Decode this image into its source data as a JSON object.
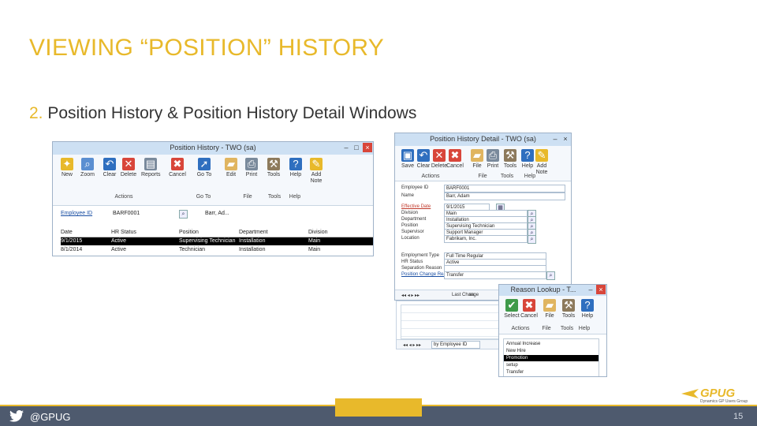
{
  "slide": {
    "title": "VIEWING “POSITION” HISTORY",
    "subtitle_number": "2.",
    "subtitle_text": "Position History & Position History Detail Windows"
  },
  "position_history": {
    "title": "Position History  -  TWO (sa)",
    "ribbon": [
      {
        "label": "New",
        "icon": "new-icon",
        "color": "#e8b92b"
      },
      {
        "label": "Zoom",
        "icon": "zoom-icon",
        "color": "#5b8fd1"
      },
      {
        "label": "Clear",
        "icon": "clear-icon",
        "color": "#2f6fbf"
      },
      {
        "label": "Delete",
        "icon": "delete-icon",
        "color": "#d8463a"
      },
      {
        "label": "Reports",
        "icon": "reports-icon",
        "color": "#7a8a9c"
      },
      {
        "label": "Cancel",
        "icon": "cancel-icon",
        "color": "#d8463a"
      },
      {
        "label": "Go To",
        "icon": "goto-icon",
        "color": "#2f6fbf"
      },
      {
        "label": "Edit",
        "icon": "folder-icon",
        "color": "#e0b560"
      },
      {
        "label": "Print",
        "icon": "print-icon",
        "color": "#7a8a9c"
      },
      {
        "label": "Tools",
        "icon": "tools-icon",
        "color": "#8d7a5c"
      },
      {
        "label": "Help",
        "icon": "help-icon",
        "color": "#2f6fbf"
      },
      {
        "label": "Add Note",
        "icon": "note-icon",
        "color": "#e8b92b"
      }
    ],
    "groups": {
      "actions": "Actions",
      "goto": "Go To",
      "file": "File",
      "tools": "Tools",
      "help": "Help"
    },
    "employee_id_label": "Employee ID",
    "employee_id": "BARF0001",
    "employee_name": "Barr, Ad...",
    "columns": [
      "Date",
      "HR Status",
      "Position",
      "Department",
      "Division"
    ],
    "rows": [
      {
        "date": "9/1/2015",
        "status": "Active",
        "position": "Supervising Technician",
        "department": "Installation",
        "division": "Main",
        "selected": true
      },
      {
        "date": "8/1/2014",
        "status": "Active",
        "position": "Technician",
        "department": "Installation",
        "division": "Main",
        "selected": false
      }
    ]
  },
  "position_detail": {
    "title": "Position History Detail  -  TWO (sa)",
    "ribbon": [
      {
        "label": "Save",
        "icon": "save-icon",
        "color": "#2f6fbf"
      },
      {
        "label": "Clear",
        "icon": "clear-icon",
        "color": "#2f6fbf"
      },
      {
        "label": "Delete",
        "icon": "delete-icon",
        "color": "#d8463a"
      },
      {
        "label": "Cancel",
        "icon": "cancel-icon",
        "color": "#d8463a"
      },
      {
        "label": "File",
        "icon": "folder-icon",
        "color": "#e0b560"
      },
      {
        "label": "Print",
        "icon": "print-icon",
        "color": "#7a8a9c"
      },
      {
        "label": "Tools",
        "icon": "tools-icon",
        "color": "#8d7a5c"
      },
      {
        "label": "Help",
        "icon": "help-icon",
        "color": "#2f6fbf"
      },
      {
        "label": "Add Note",
        "icon": "note-icon",
        "color": "#e8b92b"
      }
    ],
    "groups": {
      "actions": "Actions",
      "file": "File",
      "tools": "Tools",
      "help": "Help"
    },
    "fields": [
      {
        "label": "Employee ID",
        "value": "BARF0001"
      },
      {
        "label": "Name",
        "value": "Barr, Adam"
      },
      {
        "label": "Effective Date",
        "value": "9/1/2015"
      },
      {
        "label": "Division",
        "value": "Main"
      },
      {
        "label": "Department",
        "value": "Installation"
      },
      {
        "label": "Position",
        "value": "Supervising Technician"
      },
      {
        "label": "Supervisor",
        "value": "Support Manager"
      },
      {
        "label": "Location",
        "value": "Fabrikam, Inc."
      },
      {
        "label": "Employment Type",
        "value": "Full Time Regular"
      },
      {
        "label": "HR Status",
        "value": "Active"
      },
      {
        "label": "Separation Reason",
        "value": ""
      },
      {
        "label": "Position Change Reason",
        "value": "Transfer"
      }
    ],
    "last_change_label": "Last Change",
    "last_change_value": "sa"
  },
  "bottom_window": {
    "sort_value": "by Employee ID"
  },
  "reason_lookup": {
    "title": "Reason Lookup  -  T...",
    "ribbon": [
      {
        "label": "Select",
        "icon": "select-icon",
        "color": "#3f9a4a"
      },
      {
        "label": "Cancel",
        "icon": "cancel-icon",
        "color": "#d8463a"
      },
      {
        "label": "File",
        "icon": "folder-icon",
        "color": "#e0b560"
      },
      {
        "label": "Tools",
        "icon": "tools-icon",
        "color": "#8d7a5c"
      },
      {
        "label": "Help",
        "icon": "help-icon",
        "color": "#2f6fbf"
      }
    ],
    "groups": {
      "actions": "Actions",
      "file": "File",
      "tools": "Tools",
      "help": "Help"
    },
    "items": [
      {
        "label": "Annual Increase",
        "selected": false
      },
      {
        "label": "New Hire",
        "selected": false
      },
      {
        "label": "Promotion",
        "selected": true
      },
      {
        "label": "setup",
        "selected": false
      },
      {
        "label": "Transfer",
        "selected": false
      }
    ]
  },
  "footer": {
    "twitter_handle": "@GPUG",
    "page_number": "15",
    "logo_text": "GPUG",
    "logo_subtext": "Dynamics GP Users Group"
  }
}
